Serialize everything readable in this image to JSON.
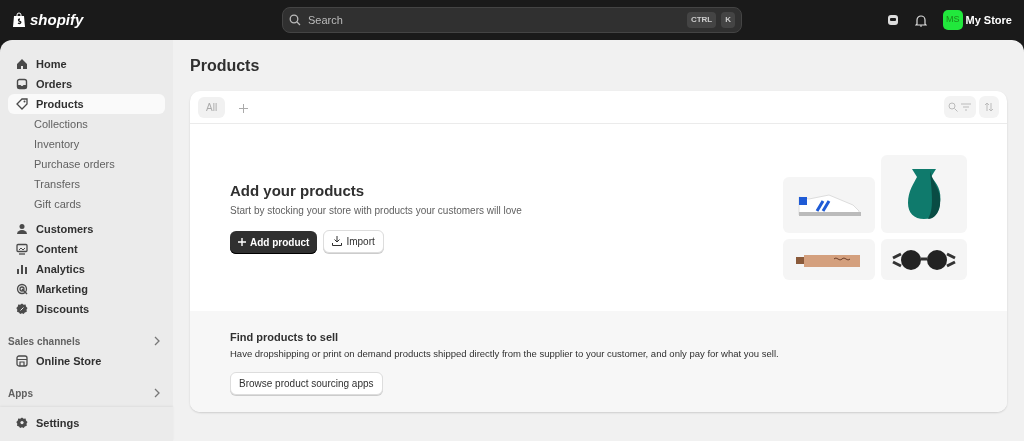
{
  "topbar": {
    "logo": "shopify",
    "search": {
      "placeholder": "Search",
      "keys": [
        "CTRL",
        "K"
      ]
    },
    "store": {
      "initials": "MS",
      "name": "My Store",
      "color": "#21e83c"
    }
  },
  "sidebar": {
    "groups": [
      {
        "items": [
          {
            "label": "Home",
            "selected": false
          },
          {
            "label": "Orders",
            "selected": false
          },
          {
            "label": "Products",
            "selected": true,
            "children": [
              {
                "label": "Collections",
                "selected": false
              },
              {
                "label": "Inventory",
                "selected": false
              },
              {
                "label": "Purchase orders",
                "selected": false
              },
              {
                "label": "Transfers",
                "selected": false
              },
              {
                "label": "Gift cards",
                "selected": false
              }
            ]
          }
        ]
      },
      {
        "items": [
          {
            "label": "Customers",
            "selected": false
          },
          {
            "label": "Content",
            "selected": false
          },
          {
            "label": "Analytics",
            "selected": false
          },
          {
            "label": "Marketing",
            "selected": false
          },
          {
            "label": "Discounts",
            "selected": false
          }
        ]
      },
      {
        "title": "Sales channels",
        "items": [
          {
            "label": "Online Store",
            "selected": false
          }
        ]
      },
      {
        "title": "Apps"
      }
    ],
    "footer": {
      "label": "Settings"
    }
  },
  "page": {
    "title": "Products",
    "tabs": [
      {
        "label": "All",
        "selected": true
      }
    ],
    "empty_state": {
      "heading": "Add your products",
      "text": "Start by stocking your store with products your customers will love",
      "primary": "Add product",
      "secondary": "Import"
    },
    "sourcing": {
      "heading": "Find products to sell",
      "text": "Have dropshipping or print on demand products shipped directly from the supplier to your customer, and only pay for what you sell.",
      "button": "Browse product sourcing apps"
    }
  }
}
